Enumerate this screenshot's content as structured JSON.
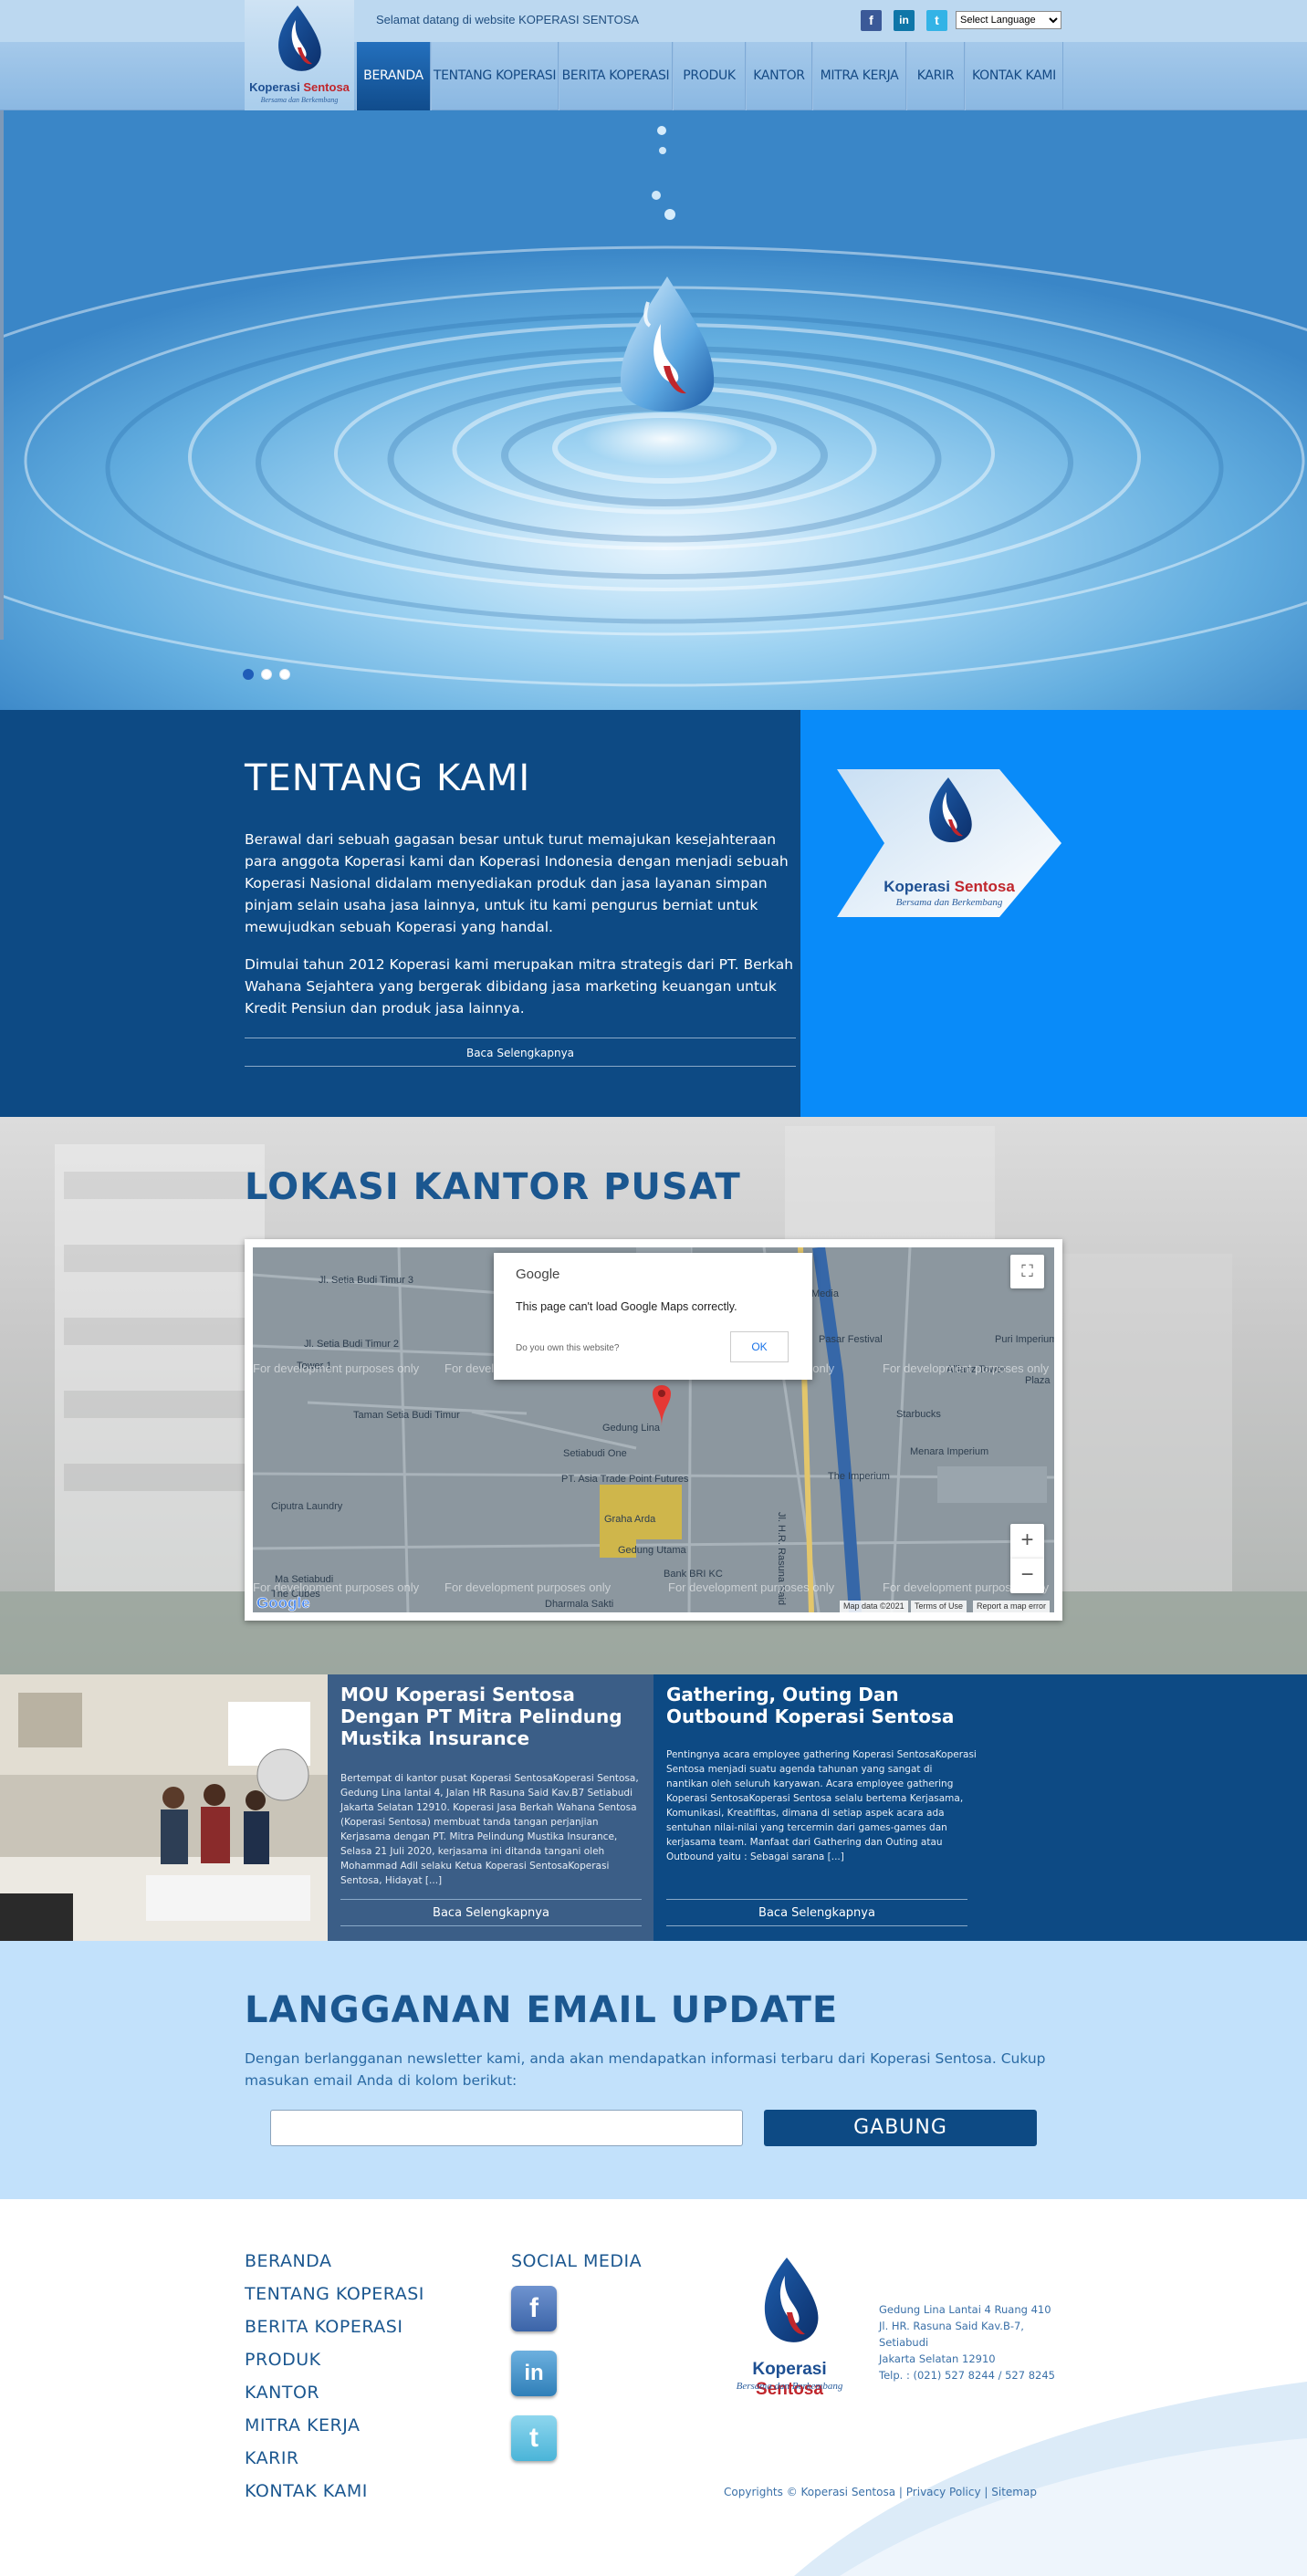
{
  "header": {
    "logo": {
      "name": "Koperasi",
      "name_accent": "Sentosa",
      "tagline": "Bersama dan Berkembang"
    },
    "welcome": "Selamat datang di website KOPERASI SENTOSA",
    "social": [
      {
        "icon": "facebook-icon",
        "glyph": "f",
        "color": "#3b5998"
      },
      {
        "icon": "linkedin-icon",
        "glyph": "in",
        "color": "#0e76a8"
      },
      {
        "icon": "twitter-icon",
        "glyph": "t",
        "color": "#33b3e6"
      }
    ],
    "language": "Select Language"
  },
  "nav": {
    "items": [
      {
        "label": "BERANDA",
        "active": true
      },
      {
        "label": "TENTANG KOPERASI",
        "active": false
      },
      {
        "label": "BERITA KOPERASI",
        "active": false
      },
      {
        "label": "PRODUK",
        "active": false
      },
      {
        "label": "KANTOR",
        "active": false
      },
      {
        "label": "MITRA KERJA",
        "active": false
      },
      {
        "label": "KARIR",
        "active": false
      },
      {
        "label": "KONTAK KAMI",
        "active": false
      }
    ]
  },
  "hero": {
    "slide_count": 3,
    "active_slide": 1
  },
  "about": {
    "title": "TENTANG KAMI",
    "p1": "Berawal dari sebuah gagasan besar untuk turut memajukan kesejahteraan para anggota Koperasi kami dan Koperasi Indonesia dengan menjadi sebuah Koperasi Nasional didalam menyediakan produk dan jasa layanan simpan pinjam selain usaha jasa lainnya, untuk itu kami pengurus berniat untuk mewujudkan sebuah Koperasi yang handal.",
    "p2": "Dimulai tahun 2012 Koperasi kami merupakan mitra strategis dari PT. Berkah Wahana Sejahtera yang bergerak dibidang jasa marketing keuangan untuk Kredit Pensiun dan produk jasa lainnya.",
    "read_more": "Baca Selengkapnya"
  },
  "location": {
    "title": "LOKASI KANTOR PUSAT",
    "map": {
      "dialog_brand": "Google",
      "dialog_message": "This page can't load Google Maps correctly.",
      "dialog_own": "Do you own this website?",
      "dialog_ok": "OK",
      "watermark": "For development purposes only",
      "footer_data": "Map data ©2021",
      "footer_terms": "Terms of Use",
      "footer_report": "Report a map error",
      "labels": [
        "Jl. Setia Budi Timur 3",
        "Jl. Setia Budi Timur 2",
        "Taman Setia Budi Timur",
        "Gedung Lina",
        "PT. Asia Trade Point Futures",
        "Graha Arda",
        "Gedung Utama",
        "Bank BRI KC",
        "Menara Imperium",
        "The Imperium",
        "Allianz Tower",
        "Starbucks",
        "Pasar Festival",
        "Media",
        "Puri Imperium",
        "Plaza",
        "The Cubes",
        "Ma Setiabudi",
        "Setiabudi One",
        "Tower 1",
        "Ciputra Laundry",
        "Dharmala Sakti",
        "Jl. H.R. Rasuna Said"
      ],
      "zoom_in": "+",
      "zoom_out": "−",
      "fullscreen": "⛶"
    }
  },
  "news": [
    {
      "title": "MOU Koperasi Sentosa Dengan PT Mitra Pelindung Mustika Insurance",
      "excerpt": "Bertempat di kantor pusat Koperasi SentosaKoperasi Sentosa, Gedung Lina lantai 4, Jalan HR Rasuna Said Kav.B7 Setiabudi Jakarta Selatan 12910. Koperasi Jasa Berkah Wahana Sentosa (Koperasi Sentosa) membuat tanda tangan perjanjian Kerjasama dengan PT. Mitra Pelindung Mustika Insurance, Selasa 21 Juli 2020, kerjasama ini ditanda tangani oleh Mohammad Adil selaku Ketua Koperasi SentosaKoperasi Sentosa, Hidayat [...]",
      "read_more": "Baca Selengkapnya"
    },
    {
      "title": "Gathering, Outing Dan Outbound Koperasi Sentosa",
      "excerpt": "Pentingnya acara employee gathering Koperasi SentosaKoperasi Sentosa menjadi suatu agenda tahunan yang sangat di nantikan oleh seluruh karyawan. Acara employee gathering Koperasi SentosaKoperasi Sentosa selalu bertema Kerjasama, Komunikasi, Kreatifitas, dimana di setiap aspek acara ada sentuhan nilai-nilai yang tercermin dari games-games dan kerjasama team. Manfaat dari Gathering dan Outing atau Outbound yaitu : Sebagai sarana [...]",
      "read_more": "Baca Selengkapnya"
    }
  ],
  "newsletter": {
    "title": "LANGGANAN EMAIL UPDATE",
    "text": "Dengan berlangganan newsletter kami, anda akan mendapatkan informasi terbaru dari Koperasi Sentosa. Cukup masukan email Anda di kolom berikut:",
    "input_value": "",
    "button": "GABUNG"
  },
  "footer": {
    "links": [
      "BERANDA",
      "TENTANG KOPERASI",
      "BERITA KOPERASI",
      "PRODUK",
      "KANTOR",
      "MITRA KERJA",
      "KARIR",
      "KONTAK KAMI"
    ],
    "social_title": "SOCIAL MEDIA",
    "social": [
      {
        "icon": "facebook-icon",
        "glyph": "f",
        "color": "#3b64a8"
      },
      {
        "icon": "linkedin-icon",
        "glyph": "in",
        "color": "#2f7fb8"
      },
      {
        "icon": "twitter-icon",
        "glyph": "t",
        "color": "#4ab4d8"
      }
    ],
    "address": [
      "Gedung Lina Lantai 4 Ruang 410",
      "Jl. HR. Rasuna Said Kav.B-7,",
      "Setiabudi",
      "Jakarta Selatan 12910",
      "Telp. : (021) 527 8244 / 527 8245"
    ],
    "copyright": "Copyrights © Koperasi Sentosa",
    "privacy": "Privacy Policy",
    "sitemap": "Sitemap",
    "separator": "|"
  }
}
